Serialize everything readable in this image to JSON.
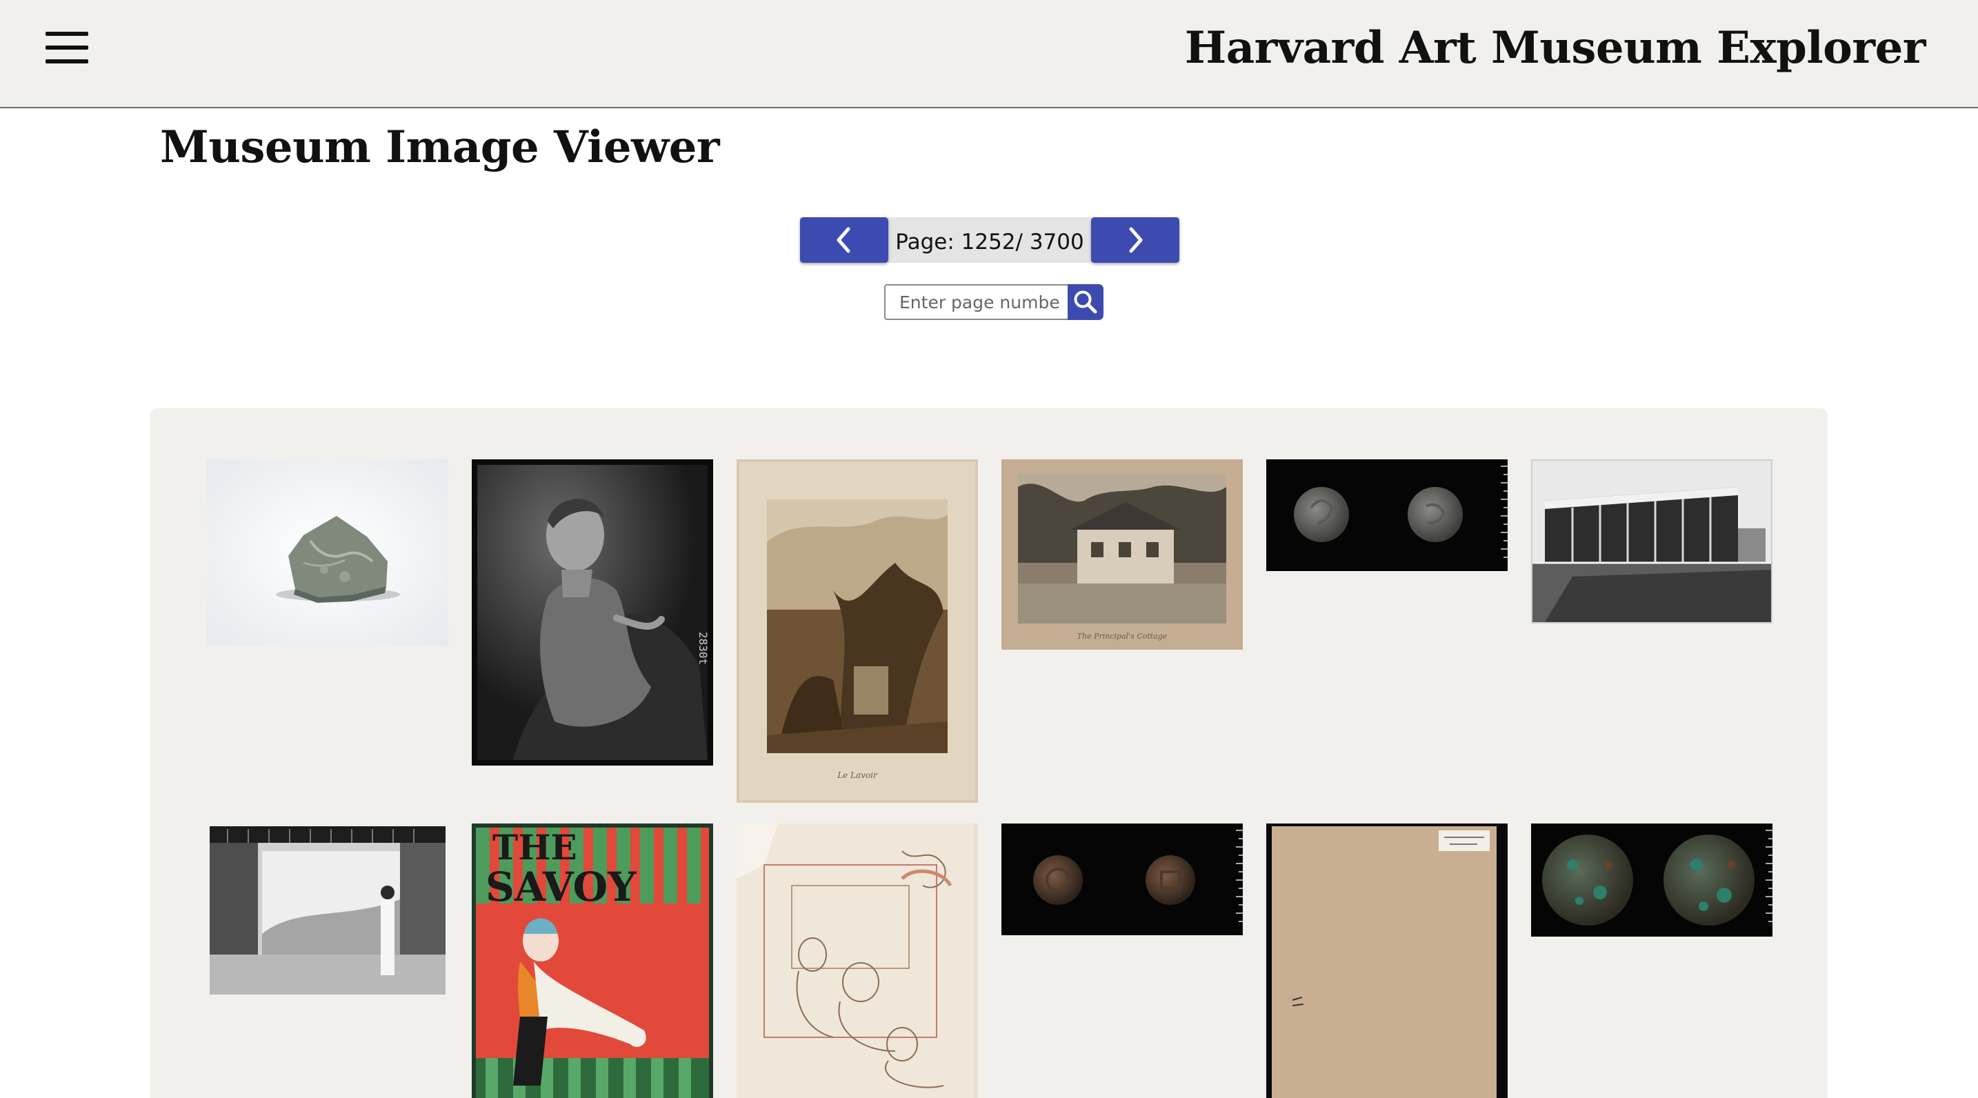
{
  "header": {
    "menu_icon": "hamburger-menu-icon",
    "app_title": "Harvard Art Museum Explorer"
  },
  "main": {
    "page_title": "Museum Image Viewer"
  },
  "pagination": {
    "prev_icon": "chevron-left-icon",
    "next_icon": "chevron-right-icon",
    "page_label": "Page: 1252/ 3700",
    "current_page": 1252,
    "total_pages": 3700
  },
  "page_search": {
    "placeholder": "Enter page number",
    "value": "",
    "button_icon": "search-icon"
  },
  "colors": {
    "accent": "#3d4bb0",
    "header_bg": "#f1f0ec",
    "gallery_bg": "#f1f0ec"
  },
  "gallery": {
    "images": [
      {
        "name": "ceramic-fragment-image"
      },
      {
        "name": "seated-woman-portrait-negative-image"
      },
      {
        "name": "landscape-etching-image"
      },
      {
        "name": "house-photograph-image"
      },
      {
        "name": "silver-coin-pair-image"
      },
      {
        "name": "modernist-building-photograph-image"
      },
      {
        "name": "woman-in-glass-pavilion-photograph-image"
      },
      {
        "name": "the-savoy-cover-image"
      },
      {
        "name": "figure-sketch-drawing-image"
      },
      {
        "name": "bronze-coin-pair-image"
      },
      {
        "name": "blank-paper-sheet-image"
      },
      {
        "name": "green-patina-coin-pair-image"
      }
    ]
  }
}
